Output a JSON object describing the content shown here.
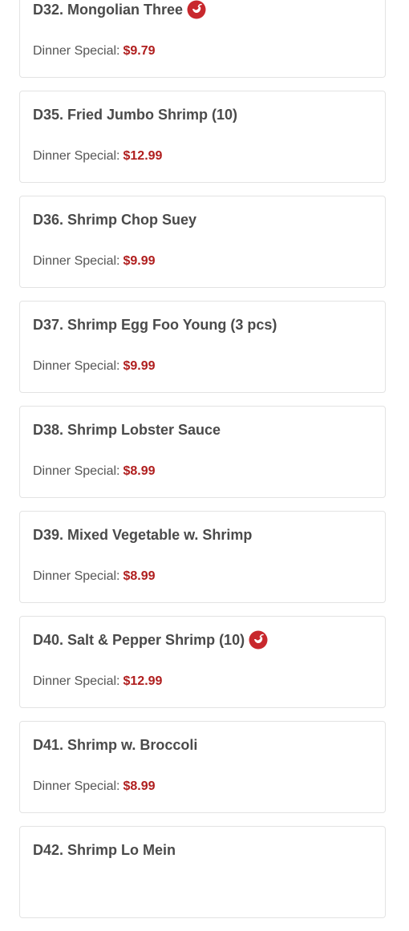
{
  "accent_color": "#b01e1e",
  "price_prefix": "Dinner Special:",
  "items": [
    {
      "title": "D32. Mongolian Three",
      "price": "$9.79",
      "spicy": true
    },
    {
      "title": "D35. Fried Jumbo Shrimp (10)",
      "price": "$12.99",
      "spicy": false
    },
    {
      "title": "D36. Shrimp Chop Suey",
      "price": "$9.99",
      "spicy": false
    },
    {
      "title": "D37. Shrimp Egg Foo Young (3 pcs)",
      "price": "$9.99",
      "spicy": false
    },
    {
      "title": "D38. Shrimp Lobster Sauce",
      "price": "$8.99",
      "spicy": false
    },
    {
      "title": "D39. Mixed Vegetable w. Shrimp",
      "price": "$8.99",
      "spicy": false
    },
    {
      "title": "D40. Salt & Pepper Shrimp (10)",
      "price": "$12.99",
      "spicy": true
    },
    {
      "title": "D41. Shrimp w. Broccoli",
      "price": "$8.99",
      "spicy": false
    },
    {
      "title": "D42. Shrimp Lo Mein",
      "price": "",
      "spicy": false
    }
  ]
}
